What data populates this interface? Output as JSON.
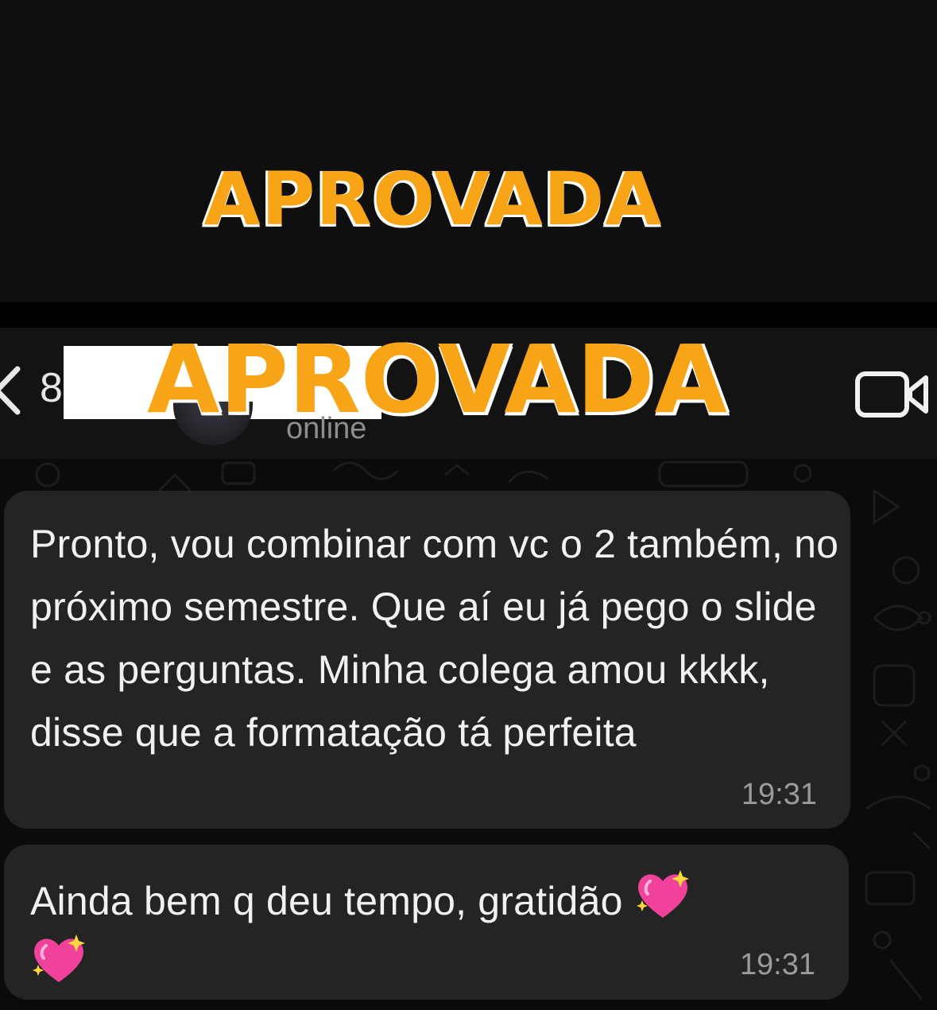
{
  "banner": {
    "title": "APROVADA"
  },
  "header": {
    "back_icon": "chevron-left-icon",
    "contact_initial": "8",
    "overlay_title": "APROVADA",
    "status": "online",
    "video_icon": "video-camera-icon"
  },
  "colors": {
    "accent": "#f7a417",
    "bubble": "#242424",
    "background": "#0b0b0b",
    "timestamp": "#9b9b9b"
  },
  "messages": [
    {
      "text": "Pronto, vou combinar com vc o 2 também, no próximo semestre. Que aí eu já pego o slide e as perguntas. Minha colega amou kkkk, disse que a formatação tá perfeita",
      "time": "19:31"
    },
    {
      "text": "Ainda bem q deu tempo, gratidão",
      "emoji": "sparkling-heart-icon",
      "time": "19:31"
    }
  ]
}
